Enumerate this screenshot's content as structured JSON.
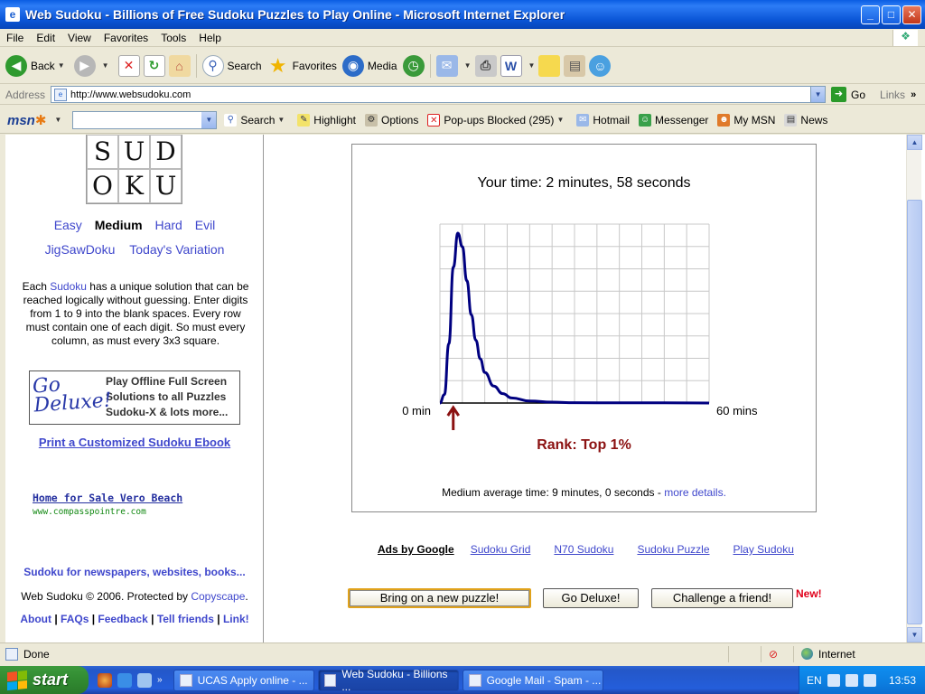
{
  "window": {
    "title": "Web Sudoku - Billions of Free Sudoku Puzzles to Play Online - Microsoft Internet Explorer",
    "app_icon": "e"
  },
  "menu": [
    "File",
    "Edit",
    "View",
    "Favorites",
    "Tools",
    "Help"
  ],
  "toolbar": {
    "back": "Back",
    "search": "Search",
    "favorites": "Favorites",
    "media": "Media"
  },
  "address": {
    "label": "Address",
    "url": "http://www.websudoku.com",
    "go": "Go",
    "links": "Links"
  },
  "msnbar": {
    "search": "Search",
    "highlight": "Highlight",
    "options": "Options",
    "popups": "Pop-ups Blocked (295)",
    "hotmail": "Hotmail",
    "messenger": "Messenger",
    "mymsn": "My MSN",
    "news": "News"
  },
  "sidebar": {
    "logo": [
      "S",
      "U",
      "D",
      "O",
      "K",
      "U"
    ],
    "levels": [
      "Easy",
      "Medium",
      "Hard",
      "Evil"
    ],
    "variations": [
      "JigSawDoku",
      "Today's Variation"
    ],
    "desc_before": "Each ",
    "desc_link": "Sudoku",
    "desc_after": " has a unique solution that can be reached logically without guessing. Enter digits from 1 to 9 into the blank spaces. Every row must contain one of each digit. So must every column, as must every 3x3 square.",
    "deluxe_logo_1": "Go",
    "deluxe_logo_2": "Deluxe!",
    "deluxe_lines": [
      "Play Offline Full Screen",
      "Solutions to all Puzzles",
      "Sudoku-X & lots more..."
    ],
    "print_link": "Print a Customized Sudoku Ebook",
    "ad_title": "Home for Sale Vero Beach",
    "ad_url": "www.compasspointre.com",
    "newspapers": "Sudoku for newspapers, websites, books...",
    "copyright": "Web Sudoku © 2006. Protected by ",
    "copyscape": "Copyscape",
    "copyright_end": ".",
    "bottom_links": [
      "About",
      "FAQs",
      "Feedback",
      "Tell friends",
      "Link!"
    ]
  },
  "result": {
    "your_time": "Your time: 2 minutes, 58 seconds",
    "rank": "Rank: Top 1%",
    "avg": "Medium average time: 9 minutes, 0 seconds  -  ",
    "more_details": "more details.",
    "axis_min": "0 min",
    "axis_max": "60 mins"
  },
  "ads": {
    "label": "Ads by Google",
    "links": [
      "Sudoku Grid",
      "N70 Sudoku",
      "Sudoku Puzzle",
      "Play Sudoku"
    ]
  },
  "buttons": {
    "new_puzzle": "Bring on a new puzzle!",
    "go_deluxe": "Go Deluxe!",
    "challenge": "Challenge a friend!",
    "new_badge": "New!"
  },
  "status": {
    "text": "Done",
    "zone": "Internet"
  },
  "taskbar": {
    "start": "start",
    "tasks": [
      "UCAS Apply online - ...",
      "Web Sudoku - Billions ...",
      "Google Mail - Spam - ..."
    ],
    "lang": "EN",
    "clock": "13:53"
  },
  "chart_data": {
    "type": "line",
    "xlabel": "",
    "ylabel": "",
    "xlim": [
      0,
      60
    ],
    "x_tick_labels": [
      "0 min",
      "60 mins"
    ],
    "grid": true,
    "marker_value": 2.97,
    "series_color": "#000080",
    "marker_color": "#8b1111",
    "x": [
      0,
      1,
      2,
      3,
      4,
      5,
      6,
      7,
      8,
      9,
      10,
      12,
      14,
      16,
      20,
      25,
      30,
      40,
      50,
      60
    ],
    "y": [
      0,
      0.05,
      0.35,
      0.8,
      1.0,
      0.92,
      0.72,
      0.52,
      0.37,
      0.26,
      0.18,
      0.1,
      0.055,
      0.03,
      0.012,
      0.005,
      0.002,
      0.001,
      0.001,
      0
    ]
  }
}
